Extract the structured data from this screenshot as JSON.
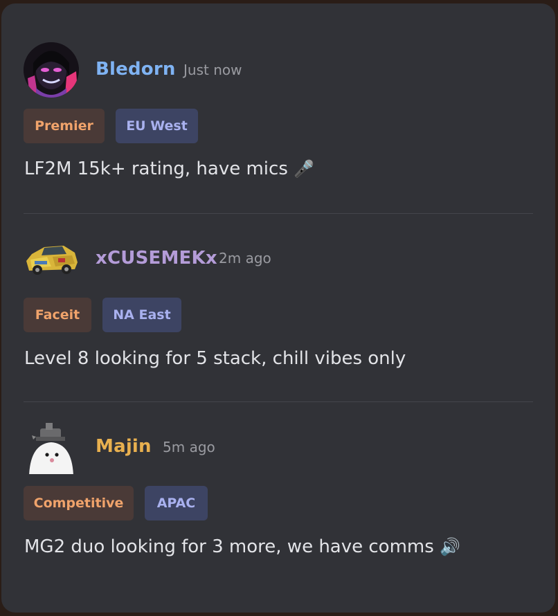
{
  "posts": [
    {
      "username": "Bledorn",
      "username_color": "#7fb3f3",
      "time": "Just now",
      "tags": {
        "mode": "Premier",
        "region": "EU West"
      },
      "message": "LF2M 15k+ rating, have mics",
      "emoji": "🎤"
    },
    {
      "username": "xCUSEMEKx",
      "username_color": "#b49cd8",
      "time": "2m ago",
      "tags": {
        "mode": "Faceit",
        "region": "NA East"
      },
      "message": "Level 8 looking for 5 stack, chill vibes only",
      "emoji": ""
    },
    {
      "username": "Majin",
      "username_color": "#e8b04f",
      "time": "5m ago",
      "tags": {
        "mode": "Competitive",
        "region": "APAC"
      },
      "message": "MG2 duo looking for 3 more, we have comms",
      "emoji": "🔊"
    }
  ],
  "colors": {
    "card_bg": "#313237",
    "mode_tag_bg": "#4a3a37",
    "mode_tag_text": "#f0a36b",
    "region_tag_bg": "#3d4463",
    "region_tag_text": "#a9b1ef"
  }
}
